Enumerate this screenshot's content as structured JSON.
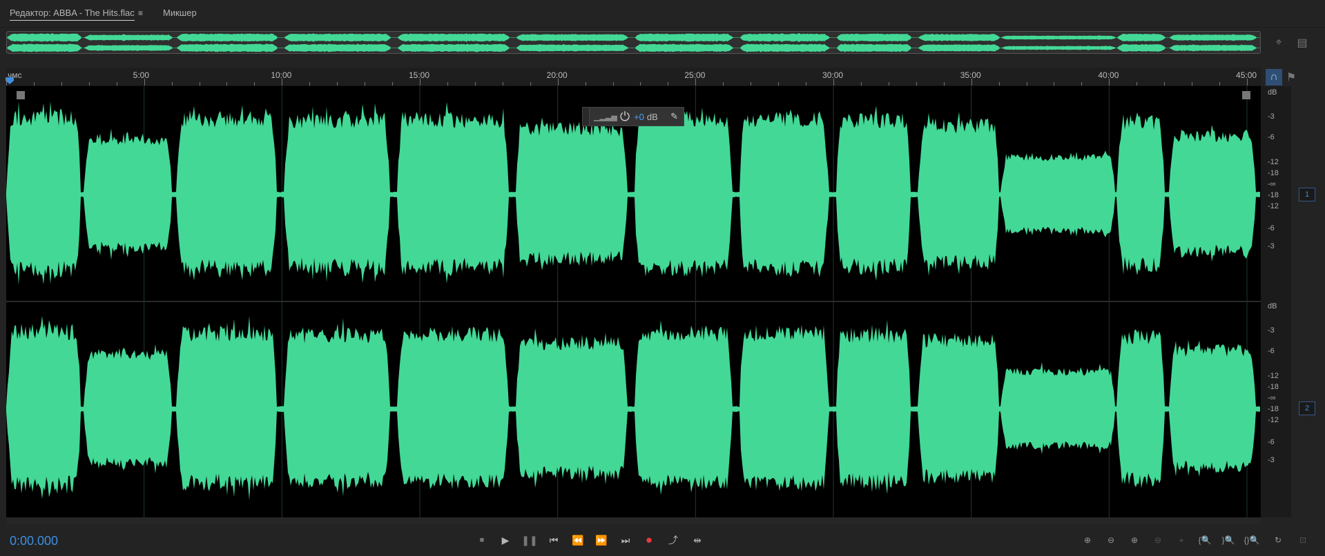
{
  "tabs": {
    "editor_label": "Редактор: ABBA - The Hits.flac",
    "menu_icon": "≡",
    "mixer_label": "Микшер"
  },
  "ruler": {
    "unit_label": "чмс",
    "labels": [
      "5:00",
      "10:00",
      "15:00",
      "20:00",
      "25:00",
      "30:00",
      "35:00",
      "40:00",
      "45:00"
    ]
  },
  "hud": {
    "gain_prefix": "+0",
    "gain_unit": "dB"
  },
  "scale": {
    "unit": "dB",
    "labels": [
      "-3",
      "-6",
      "-12",
      "-18",
      "-∞",
      "-18",
      "-12",
      "-6",
      "-3"
    ]
  },
  "channels": [
    "1",
    "2"
  ],
  "transport": {
    "time": "0:00.000"
  },
  "colors": {
    "waveform": "#43d896",
    "accent": "#3c8fe3",
    "record": "#e83a3a"
  },
  "waveform": {
    "duration_min": 45.5,
    "songs": [
      {
        "start": 0.05,
        "end": 2.7,
        "level": 0.92
      },
      {
        "start": 2.85,
        "end": 6.0,
        "level": 0.66
      },
      {
        "start": 6.2,
        "end": 9.8,
        "level": 0.9
      },
      {
        "start": 10.1,
        "end": 13.9,
        "level": 0.88
      },
      {
        "start": 14.2,
        "end": 18.2,
        "level": 0.89
      },
      {
        "start": 18.5,
        "end": 22.5,
        "level": 0.78
      },
      {
        "start": 22.8,
        "end": 26.3,
        "level": 0.9
      },
      {
        "start": 26.6,
        "end": 29.8,
        "level": 0.9
      },
      {
        "start": 30.1,
        "end": 32.8,
        "level": 0.88
      },
      {
        "start": 33.1,
        "end": 36.0,
        "level": 0.82
      },
      {
        "start": 36.1,
        "end": 40.2,
        "level": 0.45
      },
      {
        "start": 40.3,
        "end": 42.0,
        "level": 0.86
      },
      {
        "start": 42.2,
        "end": 45.3,
        "level": 0.7
      }
    ]
  }
}
